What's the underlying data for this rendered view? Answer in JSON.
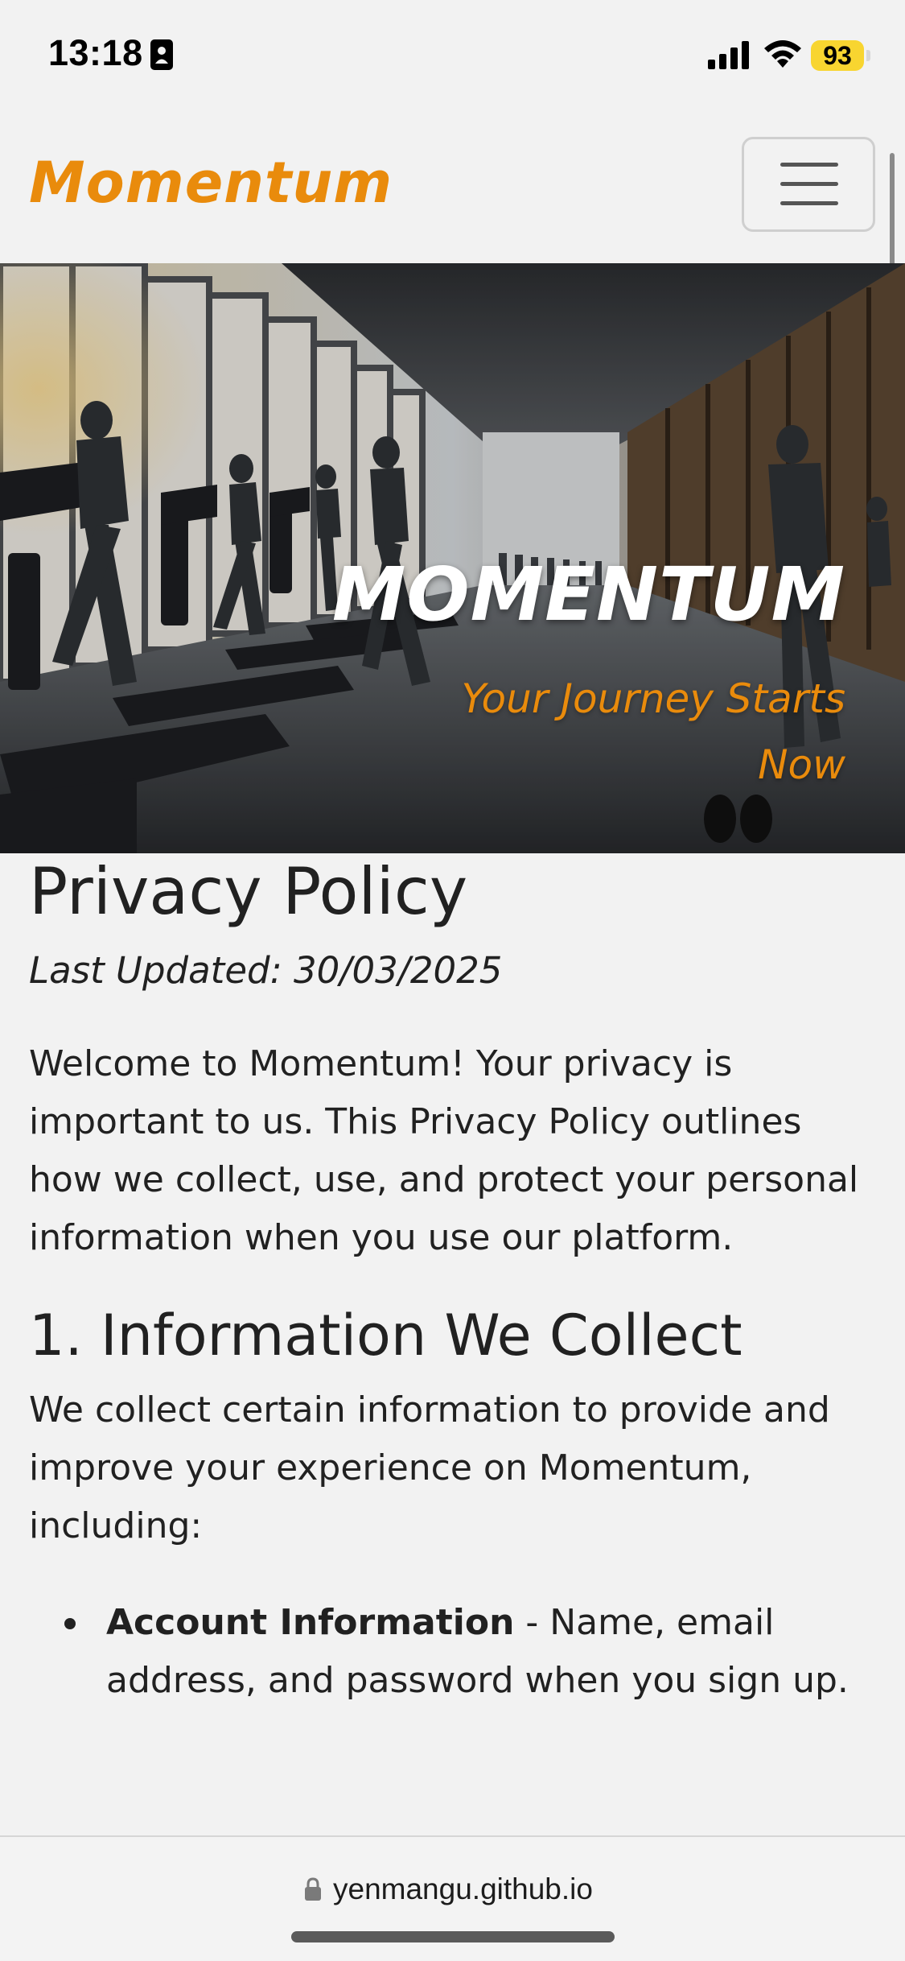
{
  "status_bar": {
    "time": "13:18",
    "battery": "93",
    "icons": [
      "id-card-icon",
      "cellular-signal-icon",
      "wifi-icon",
      "battery-icon"
    ]
  },
  "navbar": {
    "brand": "Momentum",
    "menu_icon": "hamburger-menu-icon"
  },
  "hero": {
    "title": "MOMENTUM",
    "subtitle": "Your Journey Starts Now",
    "image": "gym-treadmills-photo"
  },
  "content": {
    "title": "Privacy Policy",
    "last_updated": "Last Updated: 30/03/2025",
    "intro": "Welcome to Momentum! Your privacy is important to us. This Privacy Policy outlines how we collect, use, and protect your personal information when you use our platform.",
    "sections": [
      {
        "heading": "1. Information We Collect",
        "text": "We collect certain information to provide and improve your experience on Momentum, including:",
        "items": [
          {
            "label": "Account Information",
            "text": " - Name, email address, and password when you sign up."
          }
        ]
      }
    ]
  },
  "browser": {
    "url": "yenmangu.github.io"
  },
  "colors": {
    "accent": "#e98b0c",
    "background": "#f2f2f2",
    "text": "#212121",
    "battery": "#f8d530"
  }
}
